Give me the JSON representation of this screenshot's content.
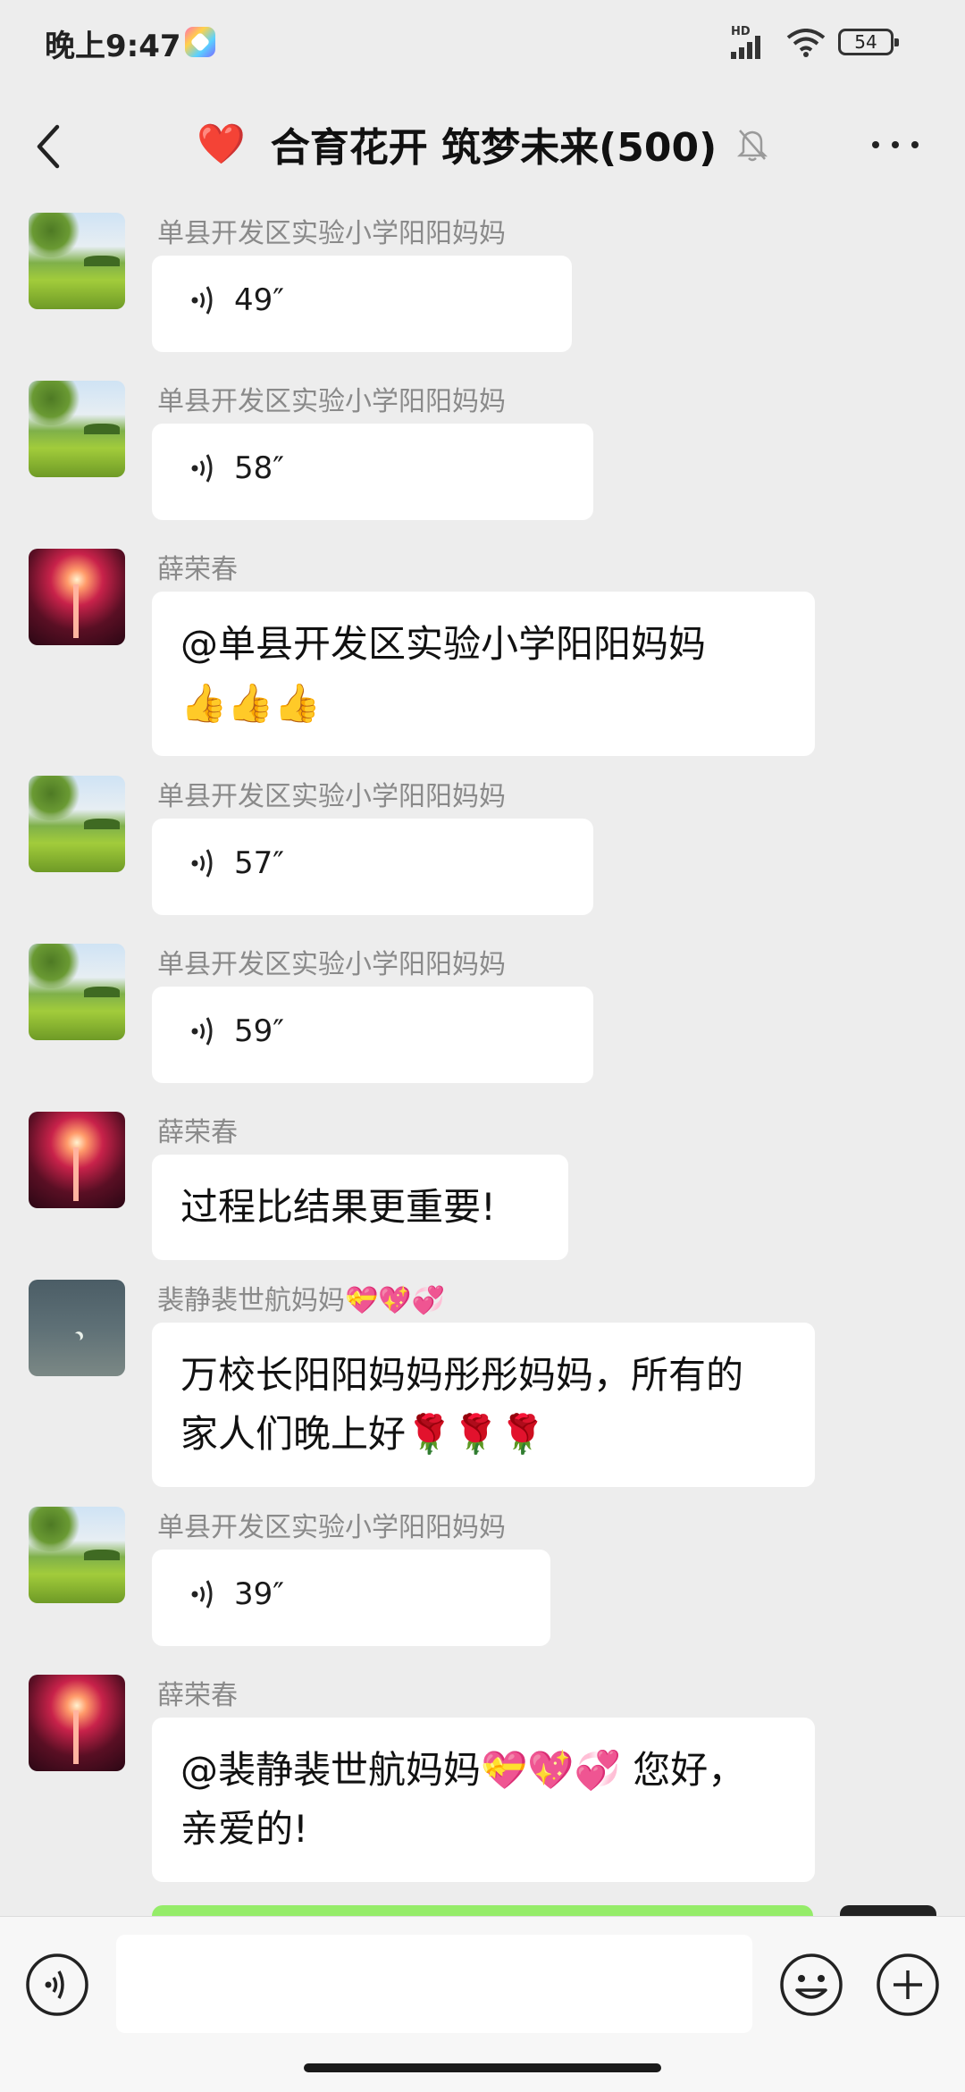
{
  "status_bar": {
    "time": "晚上9:47",
    "network": "HD",
    "battery": "54"
  },
  "header": {
    "title": "合育花开 筑梦未来(500)",
    "title_emoji": "❤️"
  },
  "messages": [
    {
      "sender": "单县开发区实验小学阳阳妈妈",
      "type": "voice",
      "duration": "49″",
      "avatar": "meadow"
    },
    {
      "sender": "单县开发区实验小学阳阳妈妈",
      "type": "voice",
      "duration": "58″",
      "avatar": "meadow"
    },
    {
      "sender": "薛荣春",
      "type": "text",
      "lines": [
        "@单县开发区实验小学阳阳妈妈",
        "👍👍👍"
      ],
      "avatar": "firework"
    },
    {
      "sender": "单县开发区实验小学阳阳妈妈",
      "type": "voice",
      "duration": "57″",
      "avatar": "meadow"
    },
    {
      "sender": "单县开发区实验小学阳阳妈妈",
      "type": "voice",
      "duration": "59″",
      "avatar": "meadow"
    },
    {
      "sender": "薛荣春",
      "type": "text",
      "lines": [
        "过程比结果更重要!"
      ],
      "avatar": "firework"
    },
    {
      "sender": "裴静裴世航妈妈💝💖💞",
      "type": "text",
      "lines": [
        "万校长阳阳妈妈彤彤妈妈，所有的",
        "家人们晚上好🌹🌹🌹"
      ],
      "avatar": "night"
    },
    {
      "sender": "单县开发区实验小学阳阳妈妈",
      "type": "voice",
      "duration": "39″",
      "avatar": "meadow"
    },
    {
      "sender": "薛荣春",
      "type": "text",
      "lines": [
        "@裴静裴世航妈妈💝💖💞 您好，",
        "亲爱的!"
      ],
      "avatar": "firework"
    }
  ],
  "input": {
    "placeholder": ""
  },
  "colors": {
    "background": "#ededed",
    "bubble": "#ffffff",
    "self_bubble": "#95ec69",
    "sender_name": "#8a8a8a"
  }
}
